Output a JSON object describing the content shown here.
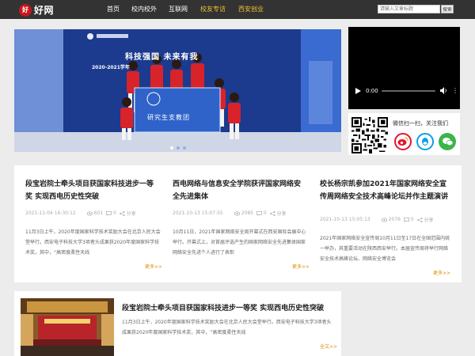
{
  "site": {
    "logo_mark": "好",
    "logo_text": "好网"
  },
  "nav": [
    {
      "label": "首页",
      "highlight": false
    },
    {
      "label": "校内校外",
      "highlight": false
    },
    {
      "label": "互联网",
      "highlight": false
    },
    {
      "label": "校友专访",
      "highlight": true
    },
    {
      "label": "西安创业",
      "highlight": true
    }
  ],
  "search": {
    "placeholder": "请输入文章标题",
    "button_label": "搜索"
  },
  "banner": {
    "headline": "科技强国  未来有我",
    "subtitle": "2020-2021学年",
    "flag_text": "研究生支教团",
    "slides": 3,
    "active_slide": 0
  },
  "video": {
    "time": "0:00",
    "more_icon": "⋮"
  },
  "social": {
    "follow_text": "微信扫一扫，关注我们",
    "icons": [
      "weibo-icon",
      "qq-icon",
      "wechat-icon"
    ]
  },
  "cards": [
    {
      "title": "段宝岩院士牵头项目获国家科技进步一等奖 实现西电历史性突破",
      "date": "2021-11-04 16:30:12",
      "views": "601",
      "comments": "0",
      "share": "分享",
      "excerpt": "11月3日上午，2020年度国家科学技术奖励大会在北京人民大会堂举行。西安电子科技大学3项者头成果获2020年度国家科学技术奖，其中，“高密度柔性天线",
      "more": "更多>>"
    },
    {
      "title": "西电网络与信息安全学院获评国家网络安全先进集体",
      "date": "2021-10-13 15:07:55",
      "views": "2085",
      "comments": "0",
      "share": "分享",
      "excerpt": "10月11日，2021年国家网络安全周开幕式在西安国际会展中心举行。开幕式上，对首届评选产生的国家网络安全先进集体国家网络安全先进个人进行了表彰",
      "more": "更多>>"
    },
    {
      "title": "校长杨宗凯参加2021年国家网络安全宣传周网络安全技术高峰论坛并作主题演讲",
      "date": "2021-10-13 15:05:13",
      "views": "2076",
      "comments": "0",
      "share": "分享",
      "excerpt": "2021年国家网络安全宣传周10月11日至17日在全国范围内统一举办，其重要活动在陕西西安举行。本届宣传周将举行网络安全技术高峰论坛、网络安全博览会",
      "more": "更多>>"
    }
  ],
  "article": {
    "title": "段宝岩院士牵头项目获国家科技进步一等奖 实现西电历史性突破",
    "excerpt": "11月3日上午，2020年度国家科学技术奖励大会在北京人民大会堂举行。西安电子科技大学3项者头成果获2020年度国家科学技术奖，其中，“高密度柔性天线",
    "more": "全文>>"
  },
  "colors": {
    "header": "#333333",
    "nav_highlight": "#f1c232",
    "more_link": "#e08a00",
    "page_bg": "#ececec"
  }
}
